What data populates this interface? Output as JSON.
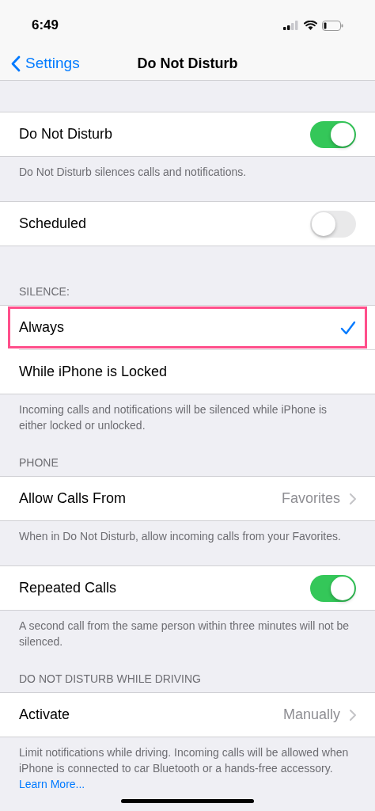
{
  "status_bar": {
    "time": "6:49"
  },
  "nav": {
    "back": "Settings",
    "title": "Do Not Disturb"
  },
  "sections": [
    {
      "rows": [
        {
          "kind": "toggle",
          "label": "Do Not Disturb",
          "on": true
        }
      ],
      "footer": {
        "text": "Do Not Disturb silences calls and notifications."
      }
    },
    {
      "rows": [
        {
          "kind": "toggle",
          "label": "Scheduled",
          "on": false
        }
      ]
    },
    {
      "header": "SILENCE:",
      "rows": [
        {
          "kind": "check",
          "label": "Always",
          "selected": true,
          "highlighted": true
        },
        {
          "kind": "check",
          "label": "While iPhone is Locked",
          "selected": false,
          "highlighted": false
        }
      ],
      "footer": {
        "text": "Incoming calls and notifications will be silenced while iPhone is either locked or unlocked."
      }
    },
    {
      "header": "PHONE",
      "rows": [
        {
          "kind": "link",
          "label": "Allow Calls From",
          "value": "Favorites"
        }
      ],
      "footer": {
        "text": "When in Do Not Disturb, allow incoming calls from your Favorites."
      }
    },
    {
      "rows": [
        {
          "kind": "toggle",
          "label": "Repeated Calls",
          "on": true
        }
      ],
      "footer": {
        "text": "A second call from the same person within three minutes will not be silenced."
      }
    },
    {
      "header": "DO NOT DISTURB WHILE DRIVING",
      "rows": [
        {
          "kind": "link",
          "label": "Activate",
          "value": "Manually"
        }
      ],
      "footer": {
        "text": "Limit notifications while driving. Incoming calls will be allowed when iPhone is connected to car Bluetooth or a hands-free accessory.",
        "link": "Learn More..."
      }
    }
  ]
}
